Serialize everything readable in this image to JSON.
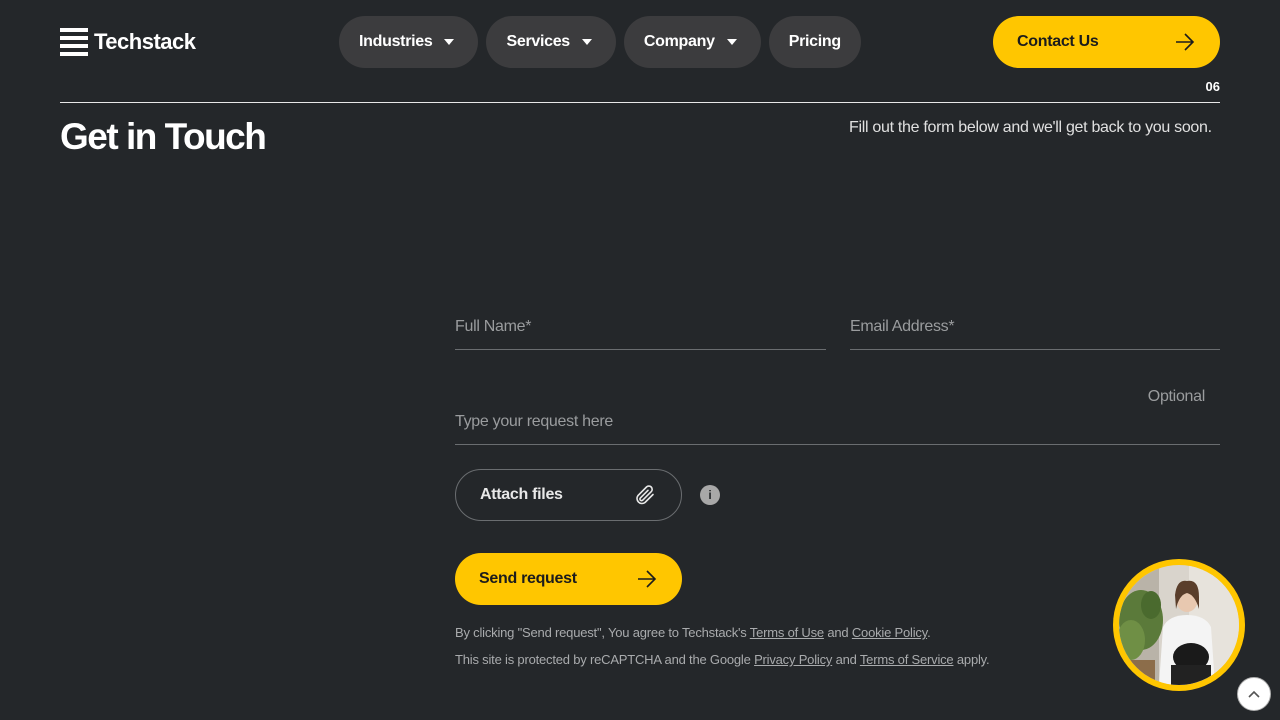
{
  "header": {
    "logo_text": "Techstack",
    "nav": [
      {
        "label": "Industries",
        "has_dropdown": true
      },
      {
        "label": "Services",
        "has_dropdown": true
      },
      {
        "label": "Company",
        "has_dropdown": true
      },
      {
        "label": "Pricing",
        "has_dropdown": false
      }
    ],
    "contact_label": "Contact Us"
  },
  "section": {
    "number": "06",
    "title": "Get in Touch",
    "subtitle": "Fill out the form below and we'll get back to you soon."
  },
  "form": {
    "full_name_placeholder": "Full Name*",
    "email_placeholder": "Email Address*",
    "request_placeholder": "Type your request here",
    "optional_label": "Optional",
    "attach_label": "Attach files",
    "info_glyph": "i",
    "send_label": "Send request"
  },
  "legal": {
    "line1_prefix": "By clicking \"Send request\", You agree to Techstack's ",
    "terms_of_use": "Terms of Use",
    "and": " and ",
    "cookie_policy": "Cookie Policy",
    "line1_suffix": ".",
    "line2_prefix": "This site is protected by reCAPTCHA and the Google ",
    "privacy_policy": "Privacy Policy",
    "terms_of_service": "Terms of Service",
    "line2_suffix": " apply."
  },
  "colors": {
    "background": "#24272a",
    "accent": "#ffc600",
    "pill": "#3c3c3e"
  },
  "icons": {
    "contact_arrow": "arrow-right-icon",
    "attach": "paperclip-icon",
    "info": "info-icon",
    "send_arrow": "arrow-right-icon",
    "scroll_top": "chevron-up-icon"
  }
}
